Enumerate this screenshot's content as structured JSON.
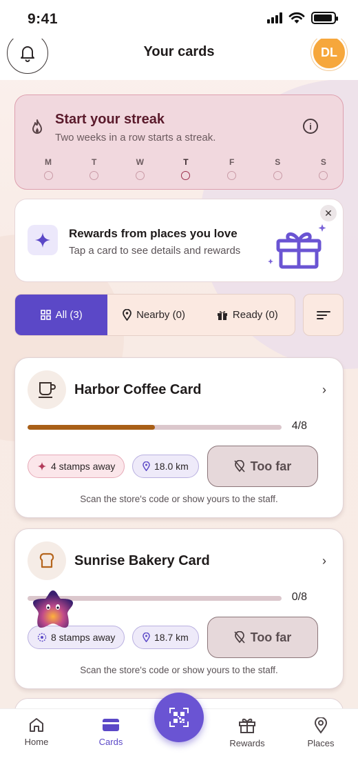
{
  "status_bar": {
    "time": "9:41"
  },
  "header": {
    "title": "Your cards",
    "avatar_initials": "DL"
  },
  "streak": {
    "title": "Start your streak",
    "subtitle": "Two weeks in a row starts a streak.",
    "days": [
      "M",
      "T",
      "W",
      "T",
      "F",
      "S",
      "S"
    ],
    "today_index": 3
  },
  "promo": {
    "title": "Rewards from places you love",
    "subtitle": "Tap a card to see details and rewards"
  },
  "filters": {
    "all": "All (3)",
    "nearby": "Nearby (0)",
    "ready": "Ready (0)",
    "active": "all"
  },
  "cards": [
    {
      "name": "Harbor Coffee Card",
      "icon": "coffee-cup-icon",
      "progress_label": "4/8",
      "progress": 0.5,
      "stamps_away": "4 stamps away",
      "distance": "18.0 km",
      "action": "Too far",
      "hint": "Scan the store's code or show yours to the staff."
    },
    {
      "name": "Sunrise Bakery Card",
      "icon": "bread-icon",
      "progress_label": "0/8",
      "progress": 0,
      "stamps_away": "8 stamps away",
      "distance": "18.7 km",
      "action": "Too far",
      "hint": "Scan the store's code or show yours to the staff."
    }
  ],
  "nav": {
    "home": "Home",
    "cards": "Cards",
    "rewards": "Rewards",
    "places": "Places",
    "active": "cards"
  },
  "colors": {
    "accent": "#5b48c7",
    "avatar": "#f6a73c",
    "streak_bg": "#f1d8de",
    "progress_fill": "#a85f17"
  }
}
